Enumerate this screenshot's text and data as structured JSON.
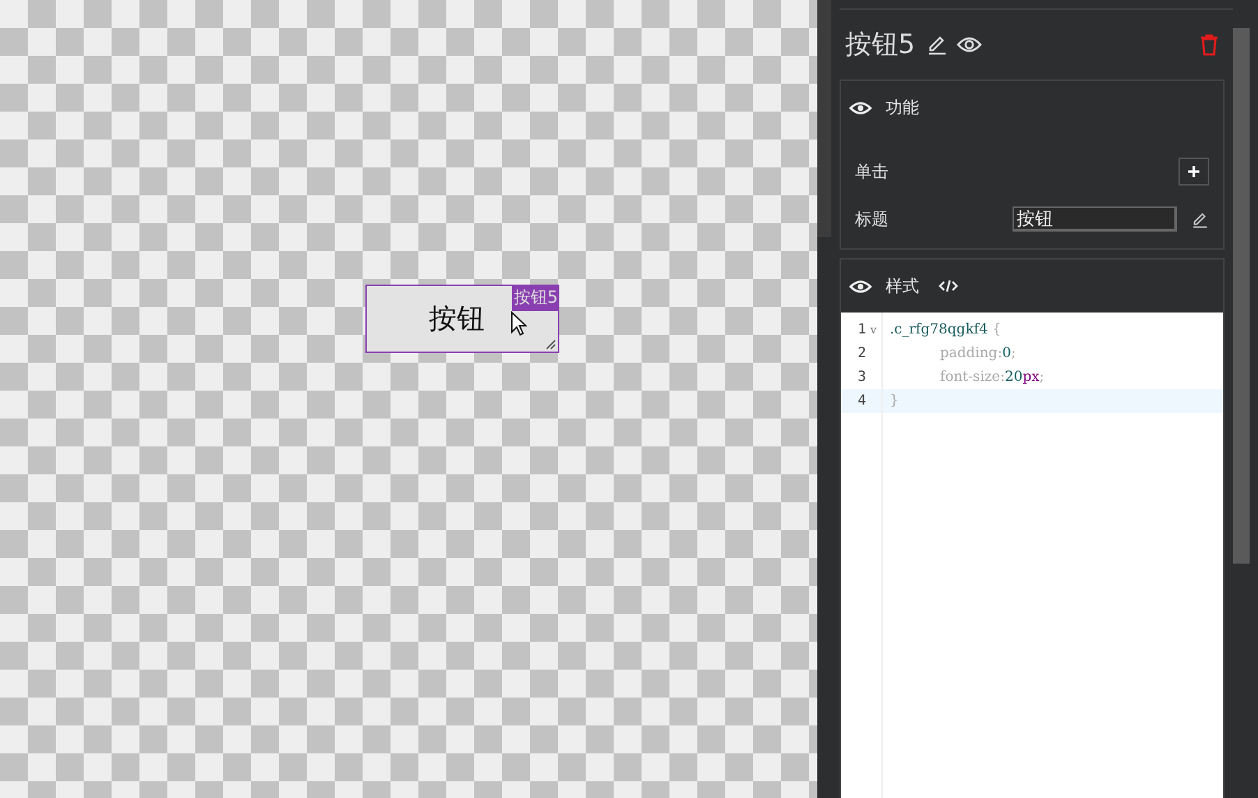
{
  "canvas": {
    "widget": {
      "label": "按钮",
      "tag": "按钮5",
      "selected": true
    }
  },
  "inspector": {
    "title": "按钮5",
    "function_section": {
      "title": "功能",
      "event": {
        "label": "单击"
      },
      "title_field": {
        "label": "标题",
        "value": "按钮"
      }
    },
    "style_section": {
      "title": "样式",
      "code_lines": [
        {
          "number": "1",
          "fold": "v",
          "current": false,
          "tokens": [
            {
              "kind": "selector",
              "text": ".c_rfg78qgkf4"
            },
            {
              "kind": "punct",
              "text": " {"
            }
          ]
        },
        {
          "number": "2",
          "current": false,
          "tokens": [
            {
              "kind": "prop",
              "text": "padding:"
            },
            {
              "kind": "number",
              "text": "0"
            },
            {
              "kind": "punct",
              "text": ";"
            }
          ]
        },
        {
          "number": "3",
          "current": false,
          "tokens": [
            {
              "kind": "prop",
              "text": "font-size:"
            },
            {
              "kind": "number",
              "text": "20"
            },
            {
              "kind": "unit",
              "text": "px"
            },
            {
              "kind": "punct",
              "text": ";"
            }
          ]
        },
        {
          "number": "4",
          "current": true,
          "tokens": [
            {
              "kind": "punct",
              "text": "}"
            }
          ]
        }
      ]
    }
  }
}
